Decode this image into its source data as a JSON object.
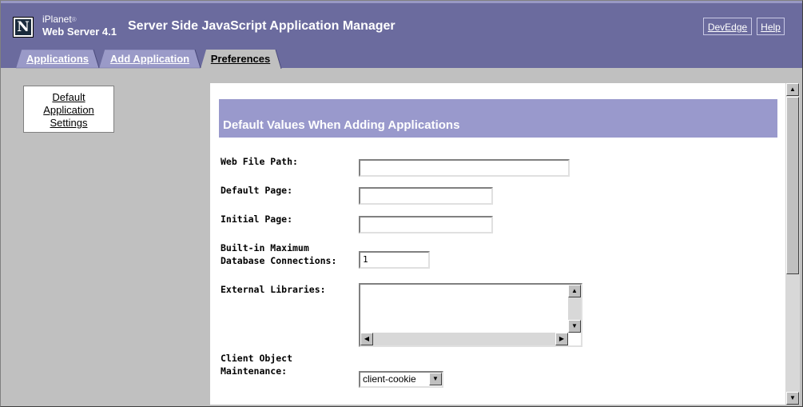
{
  "header": {
    "brand_line1": "iPlanet",
    "brand_mark": "®",
    "brand_line2": "Web Server 4.1",
    "logo_letter": "N",
    "title": "Server Side JavaScript Application Manager",
    "links": {
      "devedge": "DevEdge",
      "help": "Help"
    }
  },
  "tabs": [
    {
      "label": "Applications",
      "active": false
    },
    {
      "label": "Add Application",
      "active": false
    },
    {
      "label": "Preferences",
      "active": true
    }
  ],
  "leftnav": {
    "line1": "Default",
    "line2": "Application",
    "line3": "Settings"
  },
  "form": {
    "heading": "Default Values When Adding Applications",
    "web_file_path": {
      "label": "Web File Path:",
      "value": ""
    },
    "default_page": {
      "label": "Default Page:",
      "value": ""
    },
    "initial_page": {
      "label": "Initial Page:",
      "value": ""
    },
    "max_db_conn": {
      "label_line1": "Built-in Maximum",
      "label_line2": "Database Connections:",
      "value": "1"
    },
    "external_libraries": {
      "label": "External Libraries:",
      "value": ""
    },
    "client_object": {
      "label_line1": "Client Object",
      "label_line2": "Maintenance:",
      "value": "client-cookie"
    }
  },
  "colors": {
    "header_bg": "#6b6b9e",
    "tab_inactive": "#9a9ac8",
    "section_bg": "#9999cc",
    "page_bg": "#c0c0c0"
  },
  "icons": {
    "scroll_up": "up-arrow-icon",
    "scroll_down": "down-arrow-icon",
    "scroll_left": "left-arrow-icon",
    "scroll_right": "right-arrow-icon",
    "select_dropdown": "chevron-down-icon"
  }
}
